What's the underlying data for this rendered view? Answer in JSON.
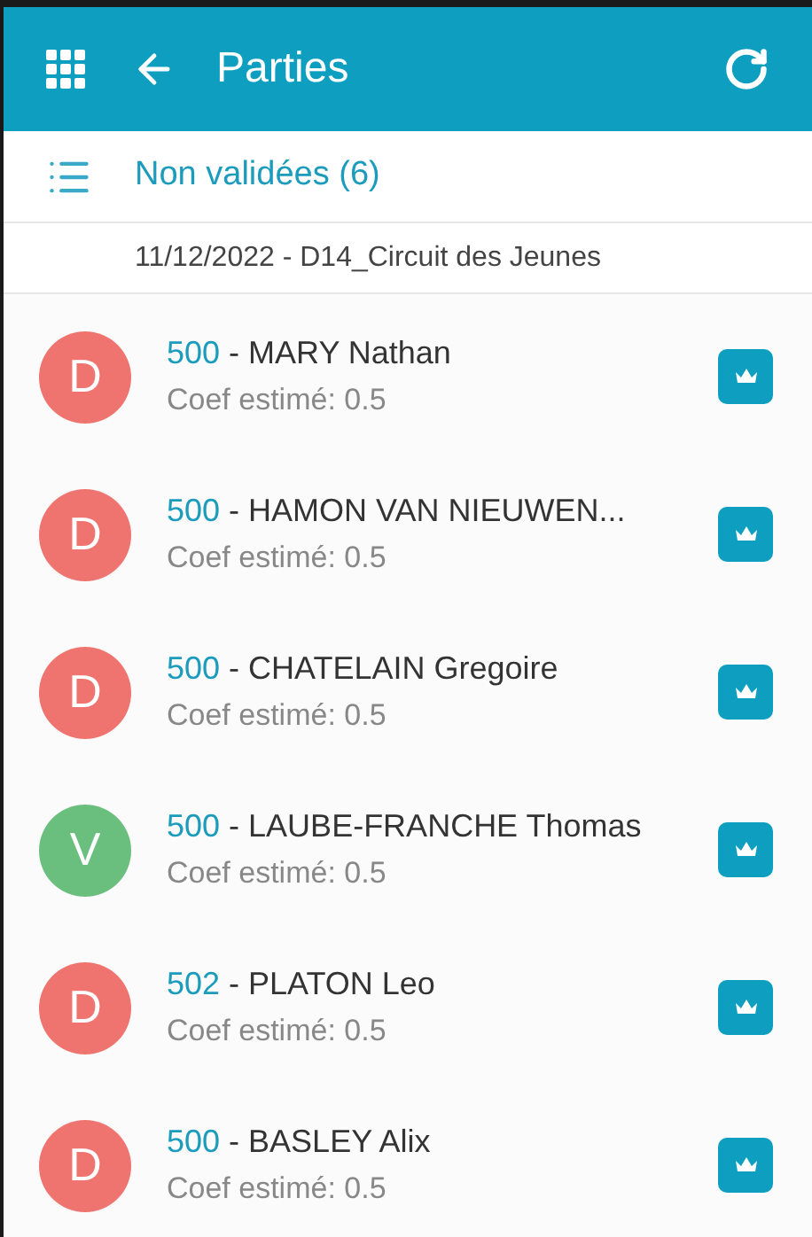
{
  "header": {
    "title": "Parties"
  },
  "filter": {
    "label": "Non validées (6)"
  },
  "event": {
    "label": "11/12/2022 - D14_Circuit des Jeunes"
  },
  "games": [
    {
      "letter": "D",
      "color": "#ef736e",
      "points": "500",
      "name": " - MARY Nathan",
      "coef": "Coef estimé: 0.5"
    },
    {
      "letter": "D",
      "color": "#ef736e",
      "points": "500",
      "name": " - HAMON VAN NIEUWEN...",
      "coef": "Coef estimé: 0.5"
    },
    {
      "letter": "D",
      "color": "#ef736e",
      "points": "500",
      "name": " - CHATELAIN Gregoire",
      "coef": "Coef estimé: 0.5"
    },
    {
      "letter": "V",
      "color": "#6bbf7e",
      "points": "500",
      "name": " - LAUBE-FRANCHE Thomas",
      "coef": "Coef estimé: 0.5"
    },
    {
      "letter": "D",
      "color": "#ef736e",
      "points": "502",
      "name": " - PLATON Leo",
      "coef": "Coef estimé: 0.5"
    },
    {
      "letter": "D",
      "color": "#ef736e",
      "points": "500",
      "name": " - BASLEY Alix",
      "coef": "Coef estimé: 0.5"
    }
  ]
}
